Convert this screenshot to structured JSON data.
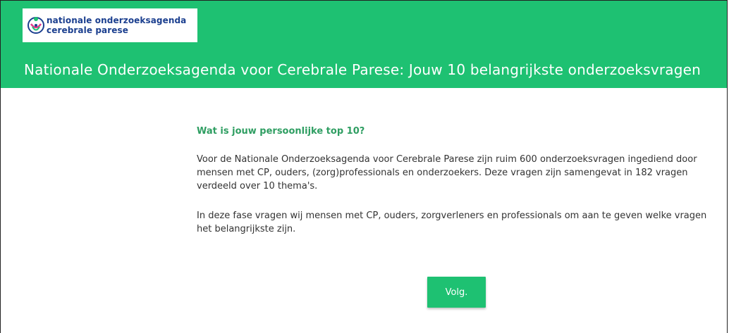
{
  "header": {
    "logo_line1": "nationale onderzoeksagenda",
    "logo_line2": "cerebrale parese",
    "title": "Nationale Onderzoeksagenda voor Cerebrale Parese: Jouw 10 belangrijkste onderzoeksvragen",
    "background_color": "#1ec172"
  },
  "main": {
    "heading": "Wat is jouw persoonlijke top 10?",
    "paragraph1": "Voor de Nationale Onderzoeksagenda voor Cerebrale Parese zijn ruim 600 onderzoeksvragen ingediend door mensen met CP, ouders, (zorg)professionals en onderzoekers. Deze vragen zijn samengevat in 182 vragen verdeeld over 10 thema's.",
    "paragraph2": "In deze fase vragen wij mensen met CP, ouders, zorgverleners en professionals om aan te geven welke vragen het belangrijkste zijn.",
    "heading_color": "#2f9e62"
  },
  "footer": {
    "next_label": "Volg."
  },
  "icons": {
    "logo": "people-circle-logo-icon"
  }
}
